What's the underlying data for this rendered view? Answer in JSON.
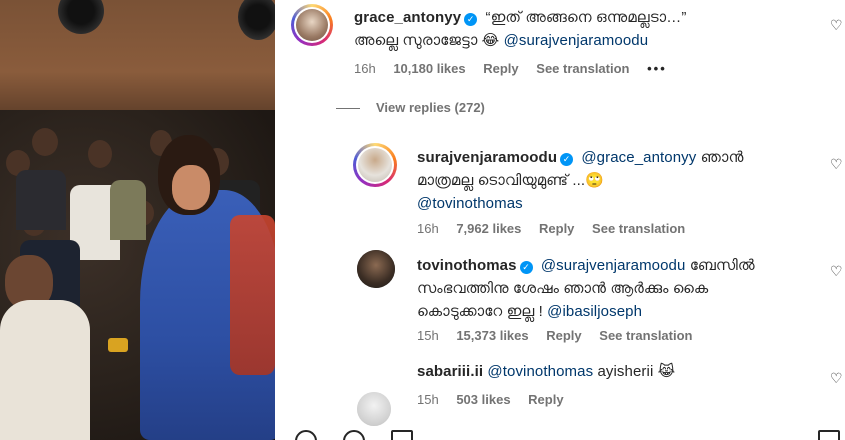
{
  "comments": [
    {
      "username": "grace_antonyy",
      "verified": true,
      "text_line1": "“ഇത് അങ്ങനെ ഒന്നുമല്ലടാ…”",
      "text_line2_prefix": "അല്ലെ സുരാജേട്ടാ 😂",
      "mention": "@surajvenjaramoodu",
      "time": "16h",
      "likes": "10,180 likes",
      "reply": "Reply",
      "see_translation": "See translation",
      "more": "•••"
    },
    {
      "username": "surajvenjaramoodu",
      "verified": true,
      "mention1": "@grace_antonyy",
      "text_line1_suffix": "ഞാൻ",
      "text_line2": "മാത്രമല്ല ടൊവിയുമുണ്ട് ...🙄",
      "mention2": "@tovinothomas",
      "time": "16h",
      "likes": "7,962 likes",
      "reply": "Reply",
      "see_translation": "See translation"
    },
    {
      "username": "tovinothomas",
      "verified": true,
      "mention1": "@surajvenjaramoodu",
      "text_line1_suffix": "ബേസിൽ",
      "text_line2": "സംഭവത്തിനു ശേഷം ഞാൻ ആർക്കും കൈ",
      "text_line3": "കൊടുക്കാറേ ഇല്ല !",
      "mention2": "@ibasiljoseph",
      "time": "15h",
      "likes": "15,373 likes",
      "reply": "Reply",
      "see_translation": "See translation"
    },
    {
      "username": "sabariii.ii",
      "mention": "@tovinothomas",
      "text": "ayisherii 😹",
      "time": "15h",
      "likes": "503 likes",
      "reply": "Reply"
    }
  ],
  "view_replies": "View replies (272)",
  "icons": {
    "heart": "heart-icon",
    "verified": "verified-badge-icon"
  },
  "colors": {
    "text": "#262626",
    "meta": "#737373",
    "mention": "#00376b",
    "verified": "#0095f6"
  }
}
